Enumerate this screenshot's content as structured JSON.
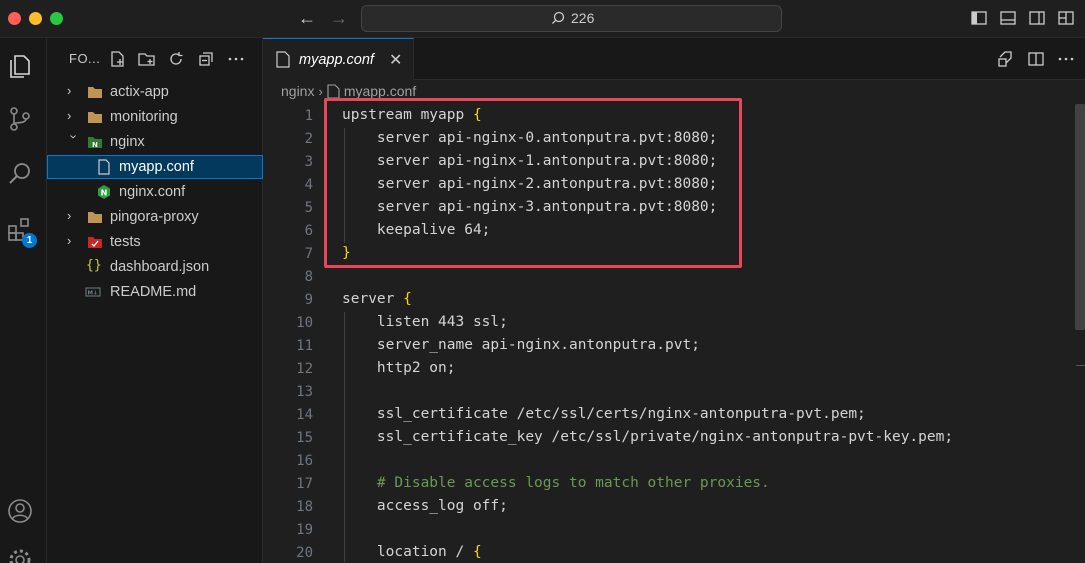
{
  "titlebar": {
    "search_text": "226",
    "nav_back": "←",
    "nav_forward": "→"
  },
  "activity": {
    "extensions_badge": "1"
  },
  "sidebar": {
    "title": "FO...",
    "items": [
      {
        "label": "actix-app",
        "type": "folder",
        "expanded": false
      },
      {
        "label": "monitoring",
        "type": "folder",
        "expanded": false
      },
      {
        "label": "nginx",
        "type": "folder-nginx",
        "expanded": true
      },
      {
        "label": "myapp.conf",
        "type": "file",
        "selected": true
      },
      {
        "label": "nginx.conf",
        "type": "nginx-file"
      },
      {
        "label": "pingora-proxy",
        "type": "folder",
        "expanded": false
      },
      {
        "label": "tests",
        "type": "folder-tests",
        "expanded": false
      },
      {
        "label": "dashboard.json",
        "type": "json"
      },
      {
        "label": "README.md",
        "type": "markdown"
      }
    ]
  },
  "editor": {
    "tab_label": "myapp.conf",
    "tab_close": "✕",
    "breadcrumb": [
      "nginx",
      "myapp.conf"
    ],
    "lines": [
      {
        "n": "1",
        "text": "upstream myapp ",
        "brace": "{"
      },
      {
        "n": "2",
        "text": "    server api-nginx-0.antonputra.pvt:8080;"
      },
      {
        "n": "3",
        "text": "    server api-nginx-1.antonputra.pvt:8080;"
      },
      {
        "n": "4",
        "text": "    server api-nginx-2.antonputra.pvt:8080;"
      },
      {
        "n": "5",
        "text": "    server api-nginx-3.antonputra.pvt:8080;"
      },
      {
        "n": "6",
        "text": "    keepalive 64;"
      },
      {
        "n": "7",
        "text": "",
        "brace": "}"
      },
      {
        "n": "8",
        "text": ""
      },
      {
        "n": "9",
        "text": "server ",
        "brace": "{"
      },
      {
        "n": "10",
        "text": "    listen 443 ssl;"
      },
      {
        "n": "11",
        "text": "    server_name api-nginx.antonputra.pvt;"
      },
      {
        "n": "12",
        "text": "    http2 on;"
      },
      {
        "n": "13",
        "text": ""
      },
      {
        "n": "14",
        "text": "    ssl_certificate /etc/ssl/certs/nginx-antonputra-pvt.pem;"
      },
      {
        "n": "15",
        "text": "    ssl_certificate_key /etc/ssl/private/nginx-antonputra-pvt-key.pem;"
      },
      {
        "n": "16",
        "text": ""
      },
      {
        "n": "17",
        "text": "    ",
        "comment": "# Disable access logs to match other proxies."
      },
      {
        "n": "18",
        "text": "    access_log off;"
      },
      {
        "n": "19",
        "text": ""
      },
      {
        "n": "20",
        "text": "    location / ",
        "brace": "{"
      }
    ]
  },
  "colors": {
    "accent": "#0078d4",
    "highlight_box": "#e8475b",
    "brace": "#ffd700",
    "comment": "#6a9955"
  }
}
